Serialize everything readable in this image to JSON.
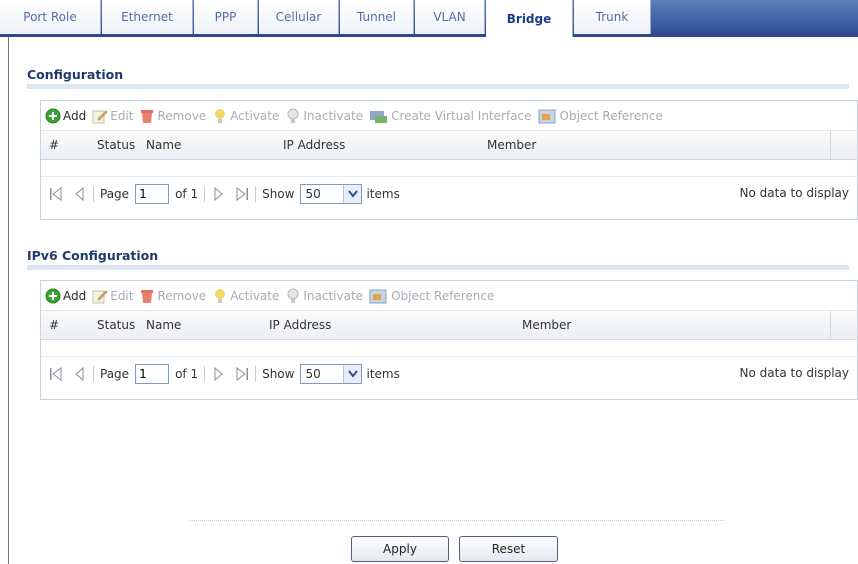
{
  "tabs": [
    {
      "label": "Port Role",
      "active": false
    },
    {
      "label": "Ethernet",
      "active": false
    },
    {
      "label": "PPP",
      "active": false
    },
    {
      "label": "Cellular",
      "active": false
    },
    {
      "label": "Tunnel",
      "active": false
    },
    {
      "label": "VLAN",
      "active": false
    },
    {
      "label": "Bridge",
      "active": true
    },
    {
      "label": "Trunk",
      "active": false
    }
  ],
  "config": {
    "title": "Configuration",
    "toolbar": {
      "add": "Add",
      "edit": "Edit",
      "remove": "Remove",
      "activate": "Activate",
      "inactivate": "Inactivate",
      "create_virtual": "Create Virtual Interface",
      "object_reference": "Object Reference"
    },
    "columns": {
      "num": "#",
      "status": "Status",
      "name": "Name",
      "ip": "IP Address",
      "member": "Member"
    },
    "pager": {
      "page_label": "Page",
      "page_value": "1",
      "of_label": "of 1",
      "show_label": "Show",
      "show_value": "50",
      "items_label": "items",
      "no_data": "No data to display"
    }
  },
  "ipv6": {
    "title": "IPv6 Configuration",
    "toolbar": {
      "add": "Add",
      "edit": "Edit",
      "remove": "Remove",
      "activate": "Activate",
      "inactivate": "Inactivate",
      "object_reference": "Object Reference"
    },
    "columns": {
      "num": "#",
      "status": "Status",
      "name": "Name",
      "ip": "IP Address",
      "member": "Member"
    },
    "pager": {
      "page_label": "Page",
      "page_value": "1",
      "of_label": "of 1",
      "show_label": "Show",
      "show_value": "50",
      "items_label": "items",
      "no_data": "No data to display"
    }
  },
  "buttons": {
    "apply": "Apply",
    "reset": "Reset"
  },
  "colors": {
    "tab_bar": "#3f62a6",
    "heading": "#1f3b6e",
    "section_rule": "#dde6f3"
  }
}
